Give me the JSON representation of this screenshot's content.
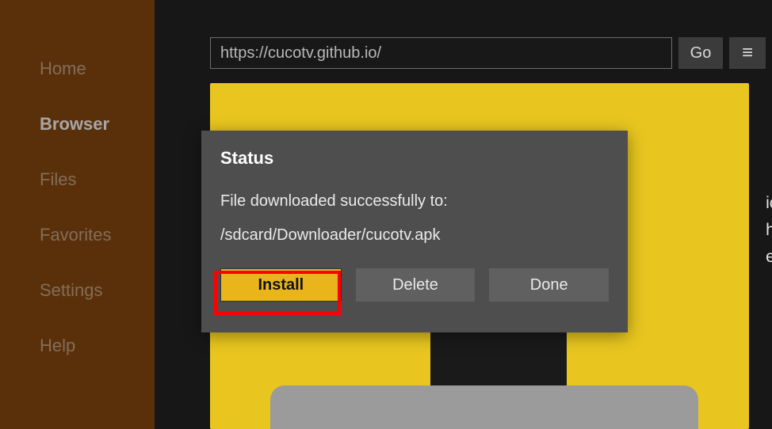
{
  "sidebar": {
    "items": [
      {
        "label": "Home"
      },
      {
        "label": "Browser"
      },
      {
        "label": "Files"
      },
      {
        "label": "Favorites"
      },
      {
        "label": "Settings"
      },
      {
        "label": "Help"
      }
    ],
    "active_index": 1
  },
  "urlbar": {
    "value": "https://cucotv.github.io/",
    "go_label": "Go",
    "menu_glyph": "≡"
  },
  "background_page": {
    "line1": "ices.",
    "line2": "hromecast,",
    "line3": "etc ..."
  },
  "dialog": {
    "title": "Status",
    "message": "File downloaded successfully to:",
    "path": "/sdcard/Downloader/cucotv.apk",
    "buttons": {
      "install": "Install",
      "delete": "Delete",
      "done": "Done"
    },
    "highlighted_button": "install"
  }
}
